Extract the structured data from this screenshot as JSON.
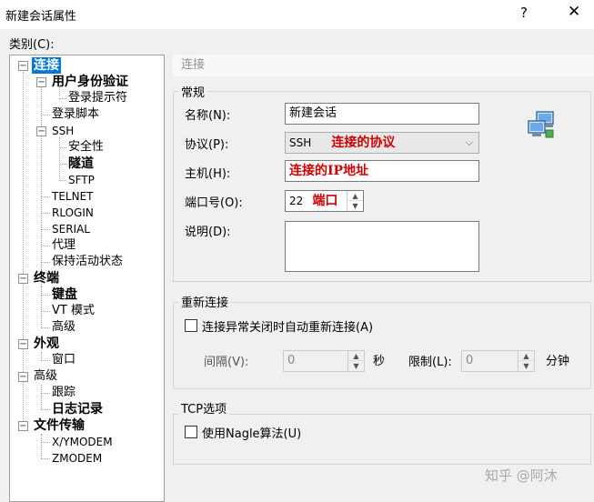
{
  "window": {
    "title": "新建会话属性",
    "help_glyph": "?",
    "close_glyph": "✕"
  },
  "category_label": "类别(C):",
  "tree": {
    "items": [
      "连接",
      "用户身份验证",
      "登录提示符",
      "登录脚本",
      "SSH",
      "安全性",
      "隧道",
      "SFTP",
      "TELNET",
      "RLOGIN",
      "SERIAL",
      "代理",
      "保持活动状态",
      "终端",
      "键盘",
      "VT 模式",
      "高级",
      "外观",
      "窗口",
      "高级",
      "跟踪",
      "日志记录",
      "文件传输",
      "X/YMODEM",
      "ZMODEM"
    ]
  },
  "panel": {
    "header": "连接",
    "general": {
      "title": "常规",
      "name_label": "名称(N):",
      "name_value": "新建会话",
      "protocol_label": "协议(P):",
      "protocol_value": "SSH",
      "protocol_note": "连接的协议",
      "host_label": "主机(H):",
      "host_note": "连接的IP地址",
      "port_label": "端口号(O):",
      "port_value": "22",
      "port_note": "端口",
      "desc_label": "说明(D):"
    },
    "reconnect": {
      "title": "重新连接",
      "checkbox_label": "连接异常关闭时自动重新连接(A)",
      "interval_label": "间隔(V):",
      "interval_value": "0",
      "interval_unit": "秒",
      "limit_label": "限制(L):",
      "limit_value": "0",
      "limit_unit": "分钟"
    },
    "tcp": {
      "title": "TCP选项",
      "checkbox_label": "使用Nagle算法(U)"
    }
  },
  "icons": {
    "network": "network-computers-icon"
  },
  "watermark": "知乎 @阿沐",
  "colors": {
    "selection": "#0078d7",
    "annotation": "#cc0000"
  }
}
